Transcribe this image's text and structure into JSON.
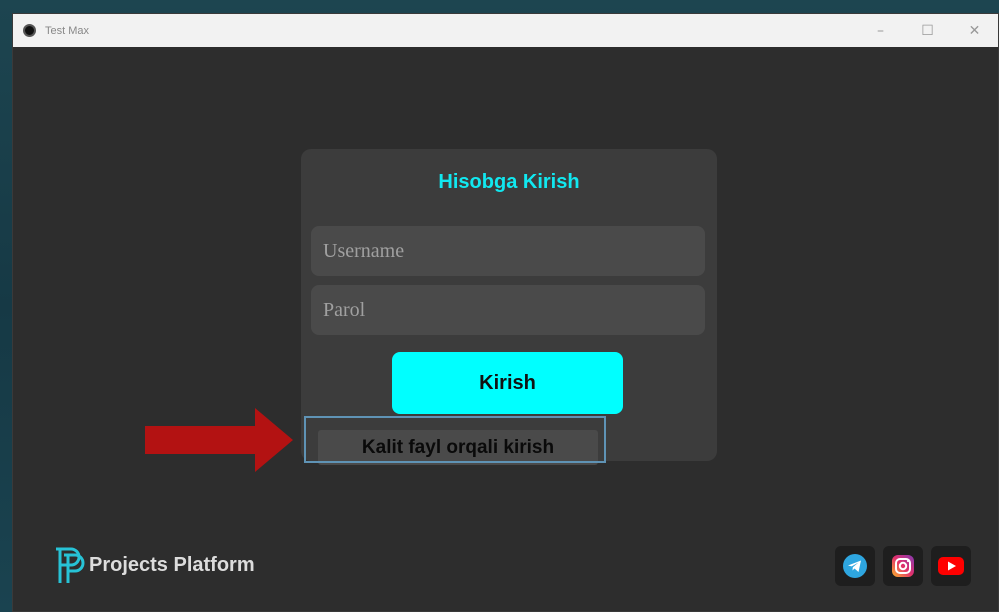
{
  "window": {
    "title": "Test Max",
    "controls": {
      "minimize": "–",
      "maximize": "☐",
      "close": "✕"
    }
  },
  "login": {
    "title": "Hisobga Kirish",
    "username_placeholder": "Username",
    "password_placeholder": "Parol",
    "submit_label": "Kirish",
    "keyfile_label": "Kalit fayl orqali kirish"
  },
  "footer": {
    "brand_name": "Projects Platform",
    "socials": [
      "telegram-icon",
      "instagram-icon",
      "youtube-icon"
    ]
  },
  "colors": {
    "accent": "#00ffff",
    "title_accent": "#11e8f0",
    "annotation_arrow": "#b31212",
    "annotation_box": "#5f93b5"
  }
}
